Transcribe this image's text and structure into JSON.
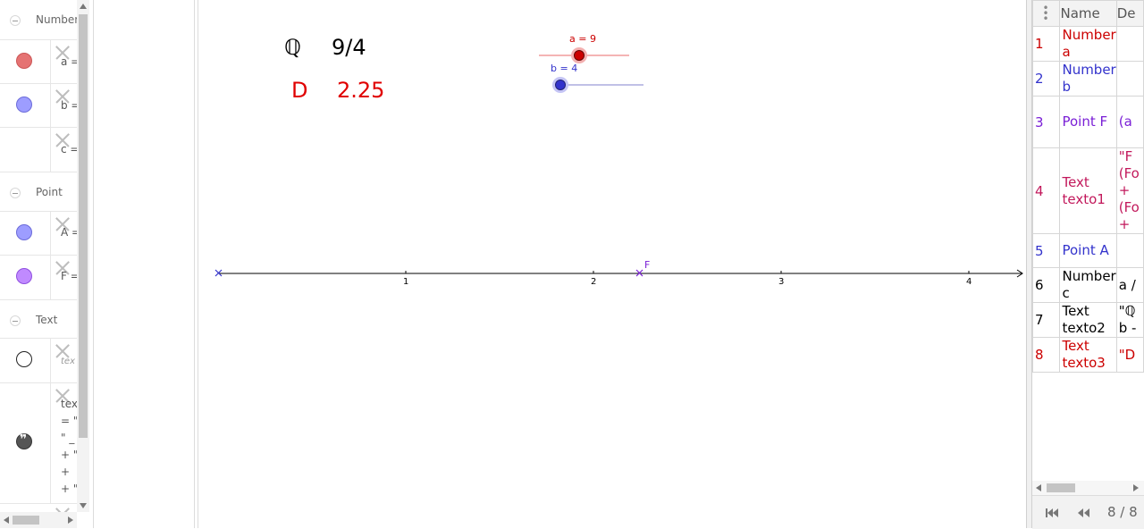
{
  "algebra": {
    "categories": [
      {
        "label": "Number"
      },
      {
        "label": "Point"
      },
      {
        "label": "Text"
      }
    ],
    "rows": [
      {
        "def": "a =",
        "marble_color": "#e57373"
      },
      {
        "def": "b =",
        "marble_color": "#9d9dff"
      },
      {
        "def": "c =",
        "marble_color": ""
      },
      {
        "def": "A =",
        "marble_color": "#9d9dff"
      },
      {
        "def": "F =",
        "marble_color": "#c08aff"
      },
      {
        "def": "tex",
        "marble_color": "#ffffff"
      },
      {
        "def": "tex\n= \"\n\" _\n+ \"\n+ \n+ \"",
        "marble_color": "#555555"
      }
    ]
  },
  "graphics": {
    "texto2": {
      "symbol": "ℚ",
      "value": "9/4",
      "color": "#000000"
    },
    "texto3": {
      "symbol": "D",
      "value": "2.25",
      "color": "#e00000"
    },
    "slider_a": {
      "label": "a = 9",
      "color": "#cc0000"
    },
    "slider_b": {
      "label": "b = 4",
      "color": "#3333cc"
    },
    "axis_ticks": [
      "1",
      "2",
      "3",
      "4"
    ],
    "point_F_label": "F"
  },
  "protocol": {
    "headers": [
      "",
      "Name",
      "De"
    ],
    "rows": [
      {
        "num": "1",
        "name": "Number\na",
        "def": "",
        "color": "#cc0000"
      },
      {
        "num": "2",
        "name": "Number\nb",
        "def": "",
        "color": "#3333cc"
      },
      {
        "num": "3",
        "name": "Point F",
        "def": "(a",
        "color": "#7a1fd6"
      },
      {
        "num": "4",
        "name": "Text\ntexto1",
        "def": "\"F\n(Fo\n+\n(Fo\n+",
        "color": "#c2185b"
      },
      {
        "num": "5",
        "name": "Point A",
        "def": "",
        "color": "#3333cc"
      },
      {
        "num": "6",
        "name": "Number\nc",
        "def": "a /",
        "color": "#000000"
      },
      {
        "num": "7",
        "name": "Text\ntexto2",
        "def": "\"ℚ\nb -",
        "color": "#000000"
      },
      {
        "num": "8",
        "name": "Text\ntexto3",
        "def": "\"D",
        "color": "#cc0000"
      }
    ],
    "page_indicator": "8 / 8"
  }
}
